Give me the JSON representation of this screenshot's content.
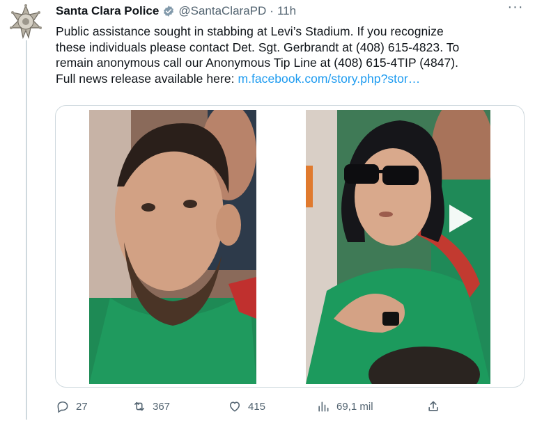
{
  "tweet": {
    "author_name": "Santa Clara Police",
    "handle": "@SantaClaraPD",
    "separator": "·",
    "time": "11h",
    "more_label": "···",
    "text_line1": "Public assistance sought in stabbing at Levi’s Stadium. If you recognize",
    "text_line2": "these individuals please contact Det. Sgt. Gerbrandt at (408) 615-4823. To",
    "text_line3": "remain anonymous call our Anonymous Tip Line at (408) 615-4TIP (4847).",
    "text_line4_prefix": "Full news release available here: ",
    "link_text": "m.facebook.com/story.php?stor…",
    "avatar_icon": "police-star-badge",
    "verified_icon": "verified-badge-icon",
    "link_color": "#1d9bf0"
  },
  "metrics": {
    "replies": "27",
    "retweets": "367",
    "likes": "415",
    "views": "69,1 mil"
  },
  "media": {
    "photo_left_desc_icon": "photo",
    "photo_right_desc_icon": "video",
    "play_icon": "play-icon"
  }
}
